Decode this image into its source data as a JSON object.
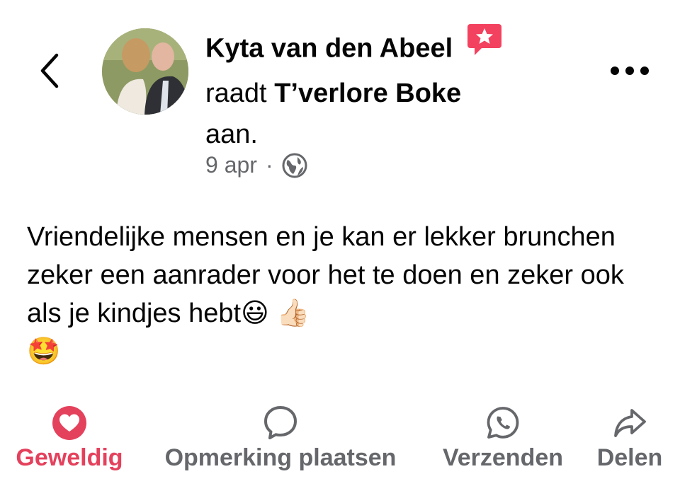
{
  "header": {
    "author_name": "Kyta van den Abeel",
    "recommend_verb": "raadt",
    "page_name": "T’verlore Boke",
    "recommend_suffix": "aan.",
    "date": "9 apr",
    "separator": "·",
    "privacy_icon": "globe-icon",
    "badge_icon": "recommendation-star-badge-icon",
    "badge_color": "#f3425f"
  },
  "post": {
    "text": "Vriendelijke mensen en je kan er lekker brunchen zeker een aanrader voor het te doen en zeker ook als je kindjes hebt",
    "emojis": [
      "😃",
      "👍🏻",
      "🤩"
    ]
  },
  "actions": [
    {
      "label": "Geweldig",
      "icon": "heart-reaction-icon",
      "active": true,
      "color": "#e4415c"
    },
    {
      "label": "Opmerking plaatsen",
      "icon": "comment-bubble-icon",
      "active": false
    },
    {
      "label": "Verzenden",
      "icon": "whatsapp-icon",
      "active": false
    },
    {
      "label": "Delen",
      "icon": "share-arrow-icon",
      "active": false
    }
  ],
  "colors": {
    "text": "#050505",
    "secondary": "#65676b",
    "love_red": "#e4415c"
  }
}
